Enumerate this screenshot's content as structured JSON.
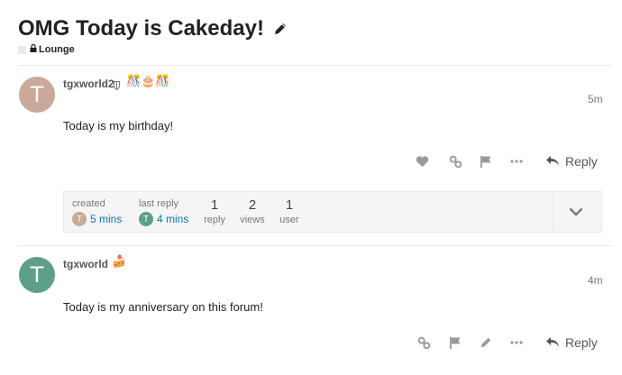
{
  "topic": {
    "title": "OMG Today is Cakeday!",
    "category": "Lounge"
  },
  "posts": [
    {
      "username": "tgxworld2",
      "avatar_letter": "T",
      "avatar_color": "#c8a99a",
      "flair_emojis": "🎊🎂🎊",
      "time": "5m",
      "body": "Today is my birthday!",
      "reply_label": "Reply"
    },
    {
      "username": "tgxworld",
      "avatar_letter": "T",
      "avatar_color": "#5e9f8a",
      "flair_emojis": "🍰",
      "time": "4m",
      "body": "Today is my anniversary on this forum!",
      "reply_label": "Reply"
    }
  ],
  "topic_map": {
    "created_label": "created",
    "created_value": "5 mins",
    "last_reply_label": "last reply",
    "last_reply_value": "4 mins",
    "replies_count": "1",
    "replies_label": "reply",
    "views_count": "2",
    "views_label": "views",
    "users_count": "1",
    "users_label": "user"
  },
  "colors": {
    "link": "#0a74b8",
    "icon": "#999999"
  }
}
